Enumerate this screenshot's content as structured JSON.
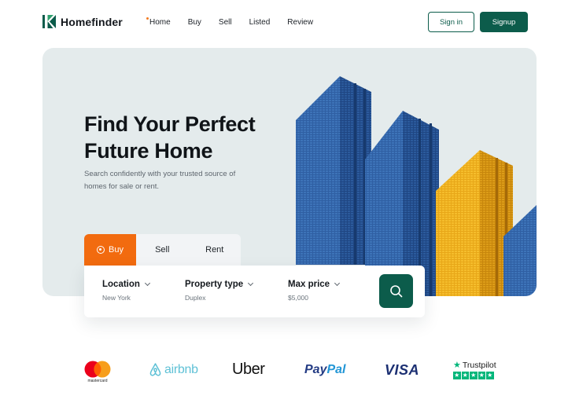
{
  "brand": {
    "name": "Homefinder",
    "color": "#0c5c4b"
  },
  "nav": {
    "items": [
      {
        "label": "Home",
        "active": true
      },
      {
        "label": "Buy"
      },
      {
        "label": "Sell"
      },
      {
        "label": "Listed"
      },
      {
        "label": "Review"
      }
    ]
  },
  "auth": {
    "signin_label": "Sign in",
    "signup_label": "Signup"
  },
  "hero": {
    "title_line1": "Find Your Perfect",
    "title_line2": "Future Home",
    "subtitle": "Search confidently with your trusted source of homes for sale or rent."
  },
  "tabs": [
    {
      "label": "Buy",
      "active": true
    },
    {
      "label": "Sell"
    },
    {
      "label": "Rent"
    }
  ],
  "search": {
    "fields": [
      {
        "label": "Location",
        "value": "New York"
      },
      {
        "label": "Property type",
        "value": "Duplex"
      },
      {
        "label": "Max price",
        "value": "$5,000"
      }
    ],
    "button_icon": "search-icon"
  },
  "partners": {
    "mastercard_label": "mastercard",
    "airbnb": "airbnb",
    "uber": "Uber",
    "paypal_a": "Pay",
    "paypal_b": "Pal",
    "visa": "VISA",
    "trustpilot": "Trustpilot"
  },
  "colors": {
    "accent_orange": "#f26b0f",
    "hero_bg": "#e4ebec",
    "trustpilot_green": "#00b67a"
  }
}
